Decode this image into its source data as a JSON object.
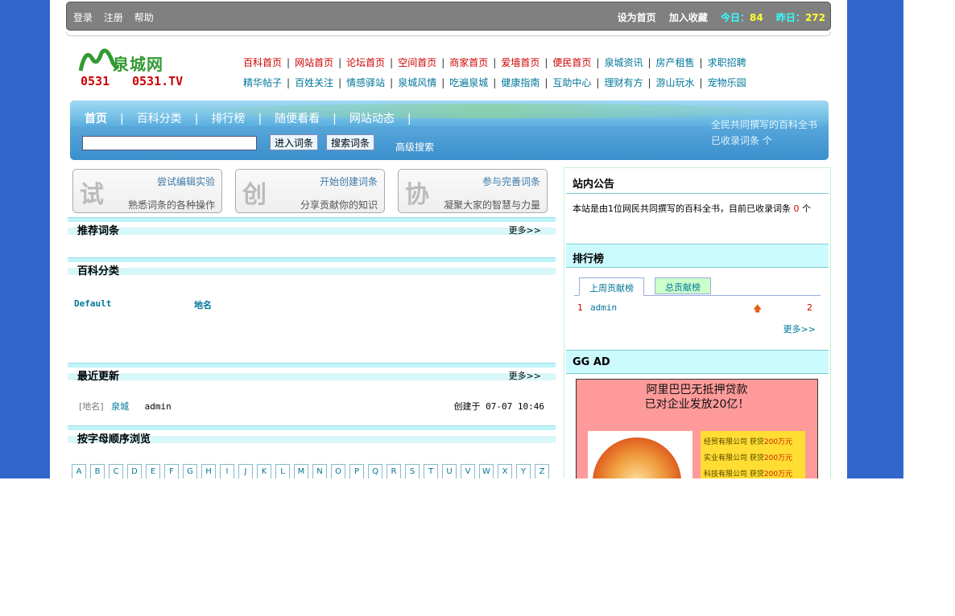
{
  "topbar": {
    "login": "登录",
    "register": "注册",
    "help": "帮助",
    "set_home": "设为首页",
    "bookmark": "加入收藏",
    "today_label": "今日：",
    "today_value": "84",
    "yesterday_label": "昨日：",
    "yesterday_value": "272"
  },
  "logo": {
    "name": "泉城网",
    "code": "0531.TV",
    "prefix": "0531"
  },
  "nav": {
    "row1": [
      "百科首页",
      "网站首页",
      "论坛首页",
      "空间首页",
      "商家首页",
      "爱墙首页",
      "便民首页",
      "泉城资讯",
      "房产租售",
      "求职招聘"
    ],
    "row2": [
      "精华帖子",
      "百姓关注",
      "情感驿站",
      "泉城风情",
      "吃遍泉城",
      "健康指南",
      "互助中心",
      "理财有方",
      "游山玩水",
      "宠物乐园"
    ]
  },
  "search": {
    "tabs": [
      "首页",
      "百科分类",
      "排行榜",
      "随便看看",
      "网站动态"
    ],
    "input_value": "",
    "btn_enter": "进入词条",
    "btn_search": "搜索词条",
    "advanced": "高级搜索",
    "slogan1": "全民共同撰写的百科全书",
    "slogan2": "已收录词条 个"
  },
  "features": [
    {
      "big": "试",
      "t1": "尝试编辑实验",
      "t2": "熟悉词条的各种操作"
    },
    {
      "big": "创",
      "t1": "开始创建词条",
      "t2": "分享贡献你的知识"
    },
    {
      "big": "协",
      "t1": "参与完善词条",
      "t2": "凝聚大家的智慧与力量"
    }
  ],
  "sections": {
    "recommended": "推荐词条",
    "categories": "百科分类",
    "recent": "最近更新",
    "alphabet": "按字母顺序浏览",
    "more": "更多>>"
  },
  "categories": [
    "Default",
    "地名"
  ],
  "recent": {
    "tag": "[地名]",
    "title": "泉城",
    "user": "admin",
    "time": "创建于 07-07 10:46"
  },
  "letters": [
    "A",
    "B",
    "C",
    "D",
    "E",
    "F",
    "G",
    "H",
    "I",
    "J",
    "K",
    "L",
    "M",
    "N",
    "O",
    "P",
    "Q",
    "R",
    "S",
    "T",
    "U",
    "V",
    "W",
    "X",
    "Y",
    "Z"
  ],
  "right": {
    "notice_title": "站内公告",
    "notice_text": "本站是由1位网民共同撰写的百科全书，目前已收录词条",
    "notice_count": "0",
    "notice_unit": "个",
    "rank_title": "排行榜",
    "rank_tab1": "上周贡献榜",
    "rank_tab2": "总贡献榜",
    "rank_rows": [
      {
        "n": "1",
        "user": "admin",
        "count": "2"
      }
    ],
    "rank_more": "更多>>",
    "ad_title": "GG AD",
    "ad_line1": "阿里巴巴无抵押贷款",
    "ad_line2": "已对企业发放20亿！",
    "ad_img2_lines": [
      [
        "经贸有限公司 获贷",
        "200万元"
      ],
      [
        "实业有限公司 获贷",
        "200万元"
      ],
      [
        "科技有限公司 获贷",
        "200万元"
      ]
    ]
  },
  "colors": {
    "page_bg": "#3366cc",
    "link_red": "#cc0000",
    "link_teal": "#007799",
    "band": "#3a8fcc"
  }
}
